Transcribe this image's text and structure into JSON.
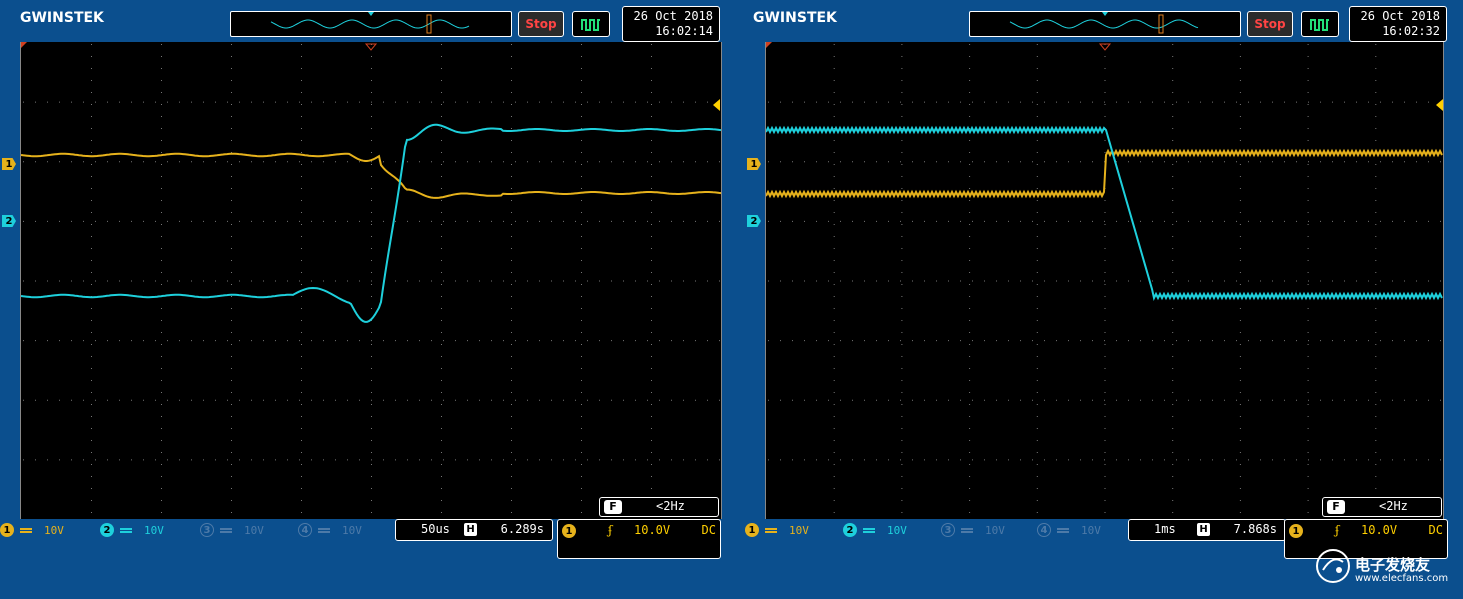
{
  "screens": [
    {
      "brand": "GWINSTEK",
      "stop_label": "Stop",
      "date": "26 Oct 2018",
      "time": "16:02:14",
      "ch1": {
        "num": "1",
        "scale": "10V",
        "color": "#e6b21c"
      },
      "ch2": {
        "num": "2",
        "scale": "10V",
        "color": "#1ed0dc"
      },
      "ch3": {
        "num": "3",
        "scale": "10V"
      },
      "ch4": {
        "num": "4",
        "scale": "10V"
      },
      "timebase": "50us",
      "h_marker": "H",
      "position": "6.289s",
      "trigger": {
        "source": "1",
        "level": "10.0V",
        "coupling": "DC"
      },
      "freq_marker": "F",
      "freq": "<2Hz"
    },
    {
      "brand": "GWINSTEK",
      "stop_label": "Stop",
      "date": "26 Oct 2018",
      "time": "16:02:32",
      "ch1": {
        "num": "1",
        "scale": "10V",
        "color": "#e6b21c"
      },
      "ch2": {
        "num": "2",
        "scale": "10V",
        "color": "#1ed0dc"
      },
      "ch3": {
        "num": "3",
        "scale": "10V"
      },
      "ch4": {
        "num": "4",
        "scale": "10V"
      },
      "timebase": "1ms",
      "h_marker": "H",
      "position": "7.868s",
      "trigger": {
        "source": "1",
        "level": "10.0V",
        "coupling": "DC"
      },
      "freq_marker": "F",
      "freq": "<2Hz"
    }
  ],
  "watermark": {
    "title": "电子发烧友",
    "url": "www.elecfans.com"
  }
}
